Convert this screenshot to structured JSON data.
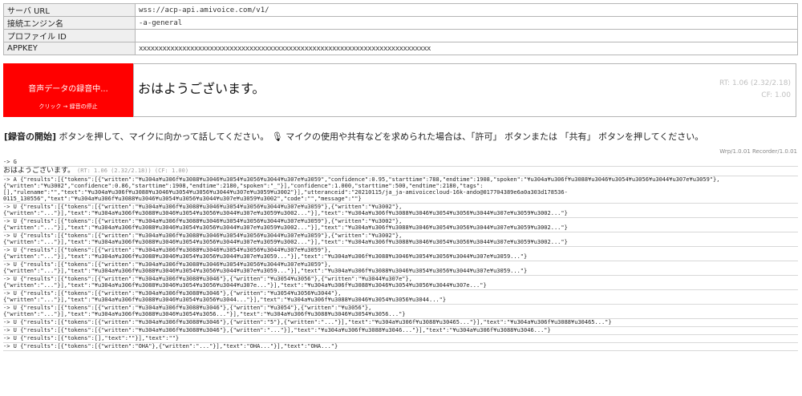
{
  "config": {
    "rows": [
      {
        "label": "サーバ URL",
        "value": "wss://acp-api.amivoice.com/v1/"
      },
      {
        "label": "接続エンジン名",
        "value": "-a-general"
      },
      {
        "label": "プロファイル ID",
        "value": ""
      },
      {
        "label": "APPKEY",
        "value": "xxxxxxxxxxxxxxxxxxxxxxxxxxxxxxxxxxxxxxxxxxxxxxxxxxxxxxxxxxxxxxxxxxxxxxxxxx",
        "masked": true
      }
    ]
  },
  "record_button": {
    "line1": "音声データの録音中...",
    "line2": "クリック → 録音の停止",
    "color": "#ff0000"
  },
  "result": {
    "text": "おはようございます。",
    "rt": "RT: 1.06 (2.32/2.18)",
    "cf": "CF: 1.00"
  },
  "instructions": {
    "bold": "[録音の開始]",
    "text": " ボタンを押して、マイクに向かって話してください。 🎙 マイクの使用や共有などを求められた場合は、「許可」 ボタンまたは 「共有」 ボタンを押してください。"
  },
  "version": "Wrp/1.0.01 Recorder/1.0.01",
  "log": {
    "entries": [
      {
        "lines": [
          "-> G"
        ]
      },
      {
        "type": "text",
        "text": "おはようございます。",
        "meta": "(RT: 1.06 (2.32/2.18)) (CF: 1.00)"
      },
      {
        "lines": [
          "-> A {\"results\":[{\"tokens\":[{\"written\":\"¥u304a¥u306f¥u3088¥u3046¥u3054¥u3056¥u3044¥u307e¥u3059\",\"confidence\":0.95,\"starttime\":788,\"endtime\":1908,\"spoken\":\"¥u304a¥u306f¥u3088¥u3046¥u3054¥u3056¥u3044¥u307e¥u3059\"},",
          "{\"written\":\"¥u3002\",\"confidence\":0.86,\"starttime\":1908,\"endtime\":2180,\"spoken\":\"_\"}],\"confidence\":1.000,\"starttime\":500,\"endtime\":2180,\"tags\":",
          "[],\"rulename\":\"\",\"text\":\"¥u304a¥u306f¥u3088¥u3046¥u3054¥u3056¥u3044¥u307e¥u3059¥u3002\"}],\"utteranceid\":\"20210115/ja_ja-amivoicecloud-16k-ando@017704389e6a0a303d178536-",
          "0115_130556\",\"text\":\"¥u304a¥u306f¥u3088¥u3046¥u3054¥u3056¥u3044¥u307e¥u3059¥u3002\",\"code\":\"\",\"message\":\"\"}"
        ]
      },
      {
        "lines": [
          "-> U {\"results\":[{\"tokens\":[{\"written\":\"¥u304a¥u306f¥u3088¥u3046¥u3054¥u3056¥u3044¥u307e¥u3059\"},{\"written\":\"¥u3002\"},",
          "{\"written\":\"...\"}],\"text\":\"¥u304a¥u306f¥u3088¥u3046¥u3054¥u3056¥u3044¥u307e¥u3059¥u3002...\"}],\"text\":\"¥u304a¥u306f¥u3088¥u3046¥u3054¥u3056¥u3044¥u307e¥u3059¥u3002...\"}"
        ]
      },
      {
        "lines": [
          "-> U {\"results\":[{\"tokens\":[{\"written\":\"¥u304a¥u306f¥u3088¥u3046¥u3054¥u3056¥u3044¥u307e¥u3059\"},{\"written\":\"¥u3002\"},",
          "{\"written\":\"...\"}],\"text\":\"¥u304a¥u306f¥u3088¥u3046¥u3054¥u3056¥u3044¥u307e¥u3059¥u3002...\"}],\"text\":\"¥u304a¥u306f¥u3088¥u3046¥u3054¥u3056¥u3044¥u307e¥u3059¥u3002...\"}"
        ]
      },
      {
        "lines": [
          "-> U {\"results\":[{\"tokens\":[{\"written\":\"¥u304a¥u306f¥u3088¥u3046¥u3054¥u3056¥u3044¥u307e¥u3059\"},{\"written\":\"¥u3002\"},",
          "{\"written\":\"...\"}],\"text\":\"¥u304a¥u306f¥u3088¥u3046¥u3054¥u3056¥u3044¥u307e¥u3059¥u3002...\"}],\"text\":\"¥u304a¥u306f¥u3088¥u3046¥u3054¥u3056¥u3044¥u307e¥u3059¥u3002...\"}"
        ]
      },
      {
        "lines": [
          "-> U {\"results\":[{\"tokens\":[{\"written\":\"¥u304a¥u306f¥u3088¥u3046¥u3054¥u3056¥u3044¥u307e¥u3059\"},",
          "{\"written\":\"...\"}],\"text\":\"¥u304a¥u306f¥u3088¥u3046¥u3054¥u3056¥u3044¥u307e¥u3059...\"}],\"text\":\"¥u304a¥u306f¥u3088¥u3046¥u3054¥u3056¥u3044¥u307e¥u3059...\"}"
        ]
      },
      {
        "lines": [
          "-> U {\"results\":[{\"tokens\":[{\"written\":\"¥u304a¥u306f¥u3088¥u3046¥u3054¥u3056¥u3044¥u307e¥u3059\"},",
          "{\"written\":\"...\"}],\"text\":\"¥u304a¥u306f¥u3088¥u3046¥u3054¥u3056¥u3044¥u307e¥u3059...\"}],\"text\":\"¥u304a¥u306f¥u3088¥u3046¥u3054¥u3056¥u3044¥u307e¥u3059...\"}"
        ]
      },
      {
        "lines": [
          "-> U {\"results\":[{\"tokens\":[{\"written\":\"¥u304a¥u306f¥u3088¥u3046\"},{\"written\":\"¥u3054¥u3056\"},{\"written\":\"¥u3044¥u307e\"},",
          "{\"written\":\"...\"}],\"text\":\"¥u304a¥u306f¥u3088¥u3046¥u3054¥u3056¥u3044¥u307e...\"}],\"text\":\"¥u304a¥u306f¥u3088¥u3046¥u3054¥u3056¥u3044¥u307e...\"}"
        ]
      },
      {
        "lines": [
          "-> U {\"results\":[{\"tokens\":[{\"written\":\"¥u304a¥u306f¥u3088¥u3046\"},{\"written\":\"¥u3054¥u3056¥u3044\"},",
          "{\"written\":\"...\"}],\"text\":\"¥u304a¥u306f¥u3088¥u3046¥u3054¥u3056¥u3044...\"}],\"text\":\"¥u304a¥u306f¥u3088¥u3046¥u3054¥u3056¥u3044...\"}"
        ]
      },
      {
        "lines": [
          "-> U {\"results\":[{\"tokens\":[{\"written\":\"¥u304a¥u306f¥u3088¥u3046\"},{\"written\":\"¥u3054\"},{\"written\":\"¥u3056\"},",
          "{\"written\":\"...\"}],\"text\":\"¥u304a¥u306f¥u3088¥u3046¥u3054¥u3056...\"}],\"text\":\"¥u304a¥u306f¥u3088¥u3046¥u3054¥u3056...\"}"
        ]
      },
      {
        "lines": [
          "-> U {\"results\":[{\"tokens\":[{\"written\":\"¥u304a¥u306f¥u3088¥u3046\"},{\"written\":\"5\"},{\"written\":\"...\"}],\"text\":\"¥u304a¥u306f¥u3088¥u30465...\"}],\"text\":\"¥u304a¥u306f¥u3088¥u30465...\"}"
        ]
      },
      {
        "lines": [
          "-> U {\"results\":[{\"tokens\":[{\"written\":\"¥u304a¥u306f¥u3088¥u3046\"},{\"written\":\"...\"}],\"text\":\"¥u304a¥u306f¥u3088¥u3046...\"}],\"text\":\"¥u304a¥u306f¥u3088¥u3046...\"}"
        ]
      },
      {
        "lines": [
          "-> U {\"results\":[{\"tokens\":[],\"text\":\"\"}],\"text\":\"\"}"
        ]
      },
      {
        "lines": [
          "-> U {\"results\":[{\"tokens\":[{\"written\":\"OHA\"},{\"written\":\"...\"}],\"text\":\"OHA...\"}],\"text\":\"OHA...\"}"
        ]
      }
    ]
  }
}
